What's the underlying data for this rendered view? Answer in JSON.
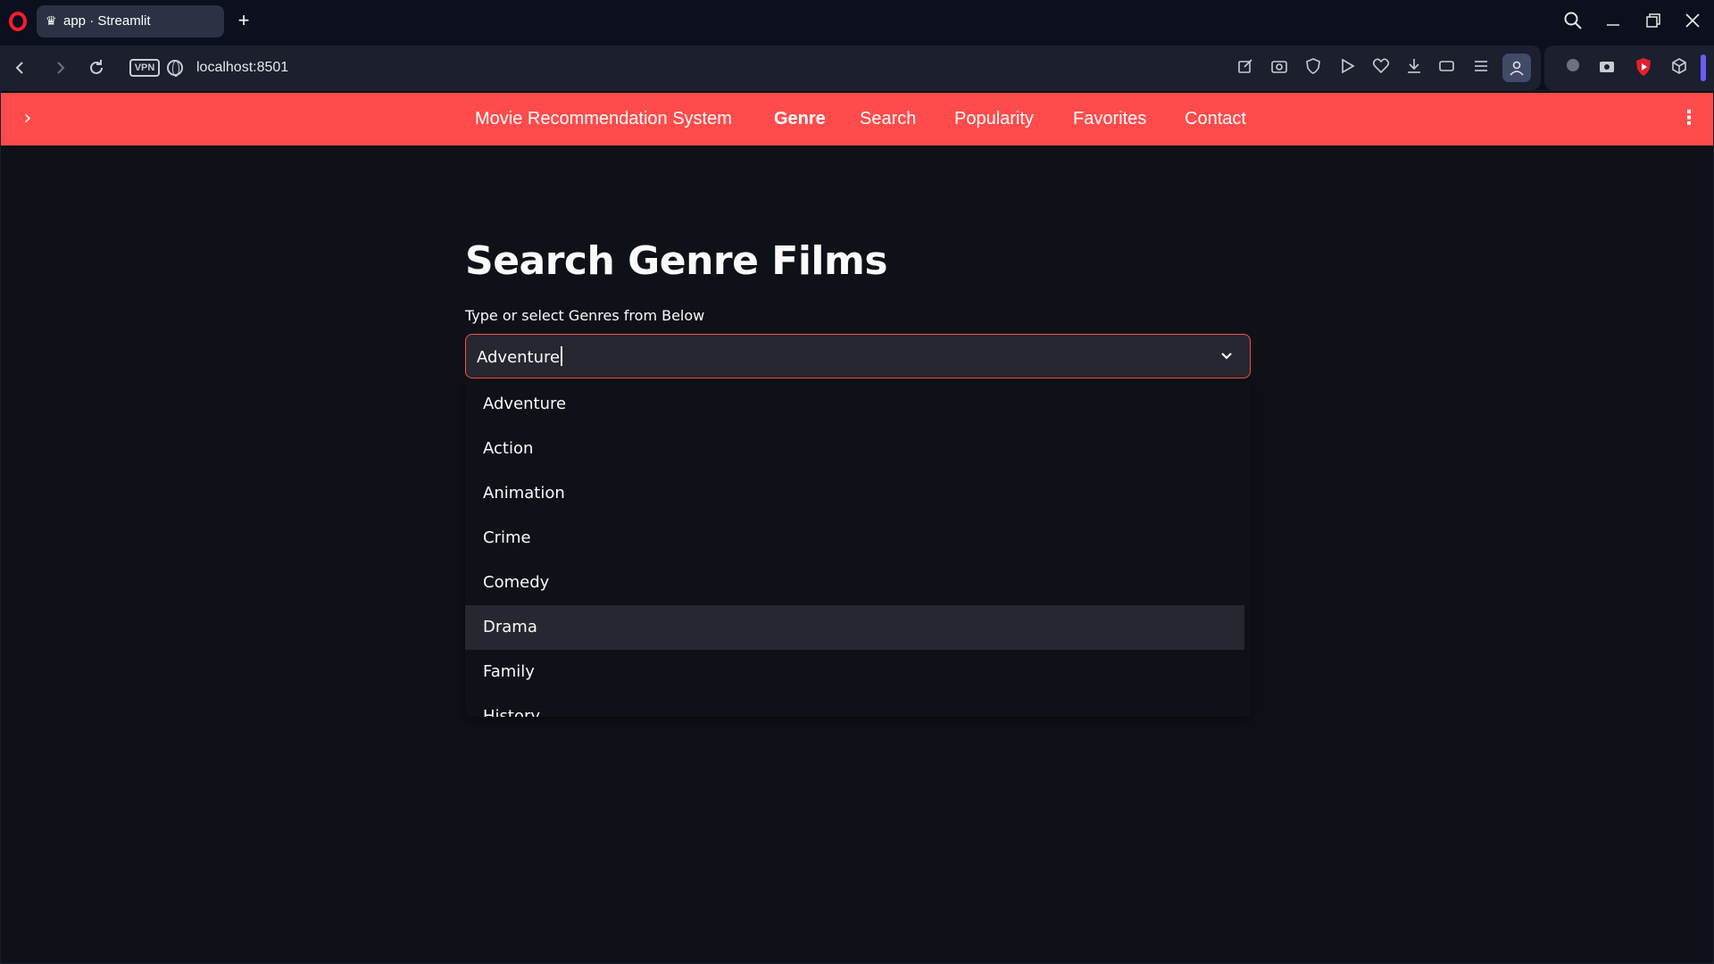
{
  "browser": {
    "tab_title": "app · Streamlit",
    "tab_icon": "streamlit-crown-icon",
    "new_tab_icon": "plus-icon",
    "url": "localhost:8501",
    "vpn_label": "VPN"
  },
  "navbar": {
    "items": [
      {
        "label": "Movie Recommendation System",
        "active": false
      },
      {
        "label": "Genre",
        "active": true
      },
      {
        "label": "Search",
        "active": false
      },
      {
        "label": "Popularity",
        "active": false
      },
      {
        "label": "Favorites",
        "active": false
      },
      {
        "label": "Contact",
        "active": false
      }
    ],
    "background": "#ff4b4b"
  },
  "main": {
    "title": "Search Genre Films",
    "select": {
      "label": "Type or select Genres from Below",
      "value": "Adventure",
      "options": [
        "Adventure",
        "Action",
        "Animation",
        "Crime",
        "Comedy",
        "Drama",
        "Family",
        "History"
      ],
      "hovered_option": "Drama"
    }
  },
  "colors": {
    "app_background": "#0e1117",
    "accent": "#ff4b4b",
    "input_background": "#262730",
    "text": "#fafafa"
  }
}
